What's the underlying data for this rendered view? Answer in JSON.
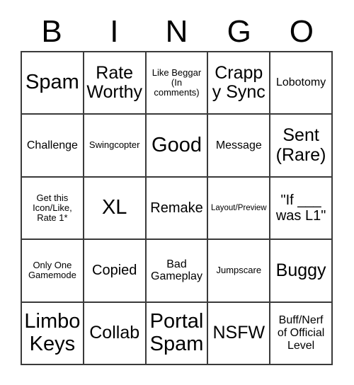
{
  "card": {
    "title": "BINGO",
    "header_letters": [
      "B",
      "I",
      "N",
      "G",
      "O"
    ],
    "grid_size": "5x5",
    "colors": {
      "background": "#ffffff",
      "text": "#000000",
      "grid_line": "#3a3a3a"
    },
    "rows": [
      [
        {
          "label": "Spam",
          "size": "fs-xl"
        },
        {
          "label": "Rate Worthy",
          "size": "fs-lg"
        },
        {
          "label": "Like Beggar (In comments)",
          "size": "fs-xs"
        },
        {
          "label": "Crappy Sync",
          "size": "fs-lg"
        },
        {
          "label": "Lobotomy",
          "size": "fs-sm"
        }
      ],
      [
        {
          "label": "Challenge",
          "size": "fs-sm"
        },
        {
          "label": "Swingcopter",
          "size": "fs-xs"
        },
        {
          "label": "Good",
          "size": "fs-xl"
        },
        {
          "label": "Message",
          "size": "fs-sm"
        },
        {
          "label": "Sent (Rare)",
          "size": "fs-lg"
        }
      ],
      [
        {
          "label": "Get this Icon/Like, Rate 1*",
          "size": "fs-xs"
        },
        {
          "label": "XL",
          "size": "fs-xl"
        },
        {
          "label": "Remake",
          "size": "fs-md"
        },
        {
          "label": "Layout/Preview",
          "size": "fs-xxs"
        },
        {
          "label": "\"If ___ was L1\"",
          "size": "fs-md"
        }
      ],
      [
        {
          "label": "Only One Gamemode",
          "size": "fs-xs"
        },
        {
          "label": "Copied",
          "size": "fs-md"
        },
        {
          "label": "Bad Gameplay",
          "size": "fs-sm"
        },
        {
          "label": "Jumpscare",
          "size": "fs-xs"
        },
        {
          "label": "Buggy",
          "size": "fs-lg"
        }
      ],
      [
        {
          "label": "Limbo Keys",
          "size": "fs-xl"
        },
        {
          "label": "Collab",
          "size": "fs-lg"
        },
        {
          "label": "Portal Spam",
          "size": "fs-xl"
        },
        {
          "label": "NSFW",
          "size": "fs-lg"
        },
        {
          "label": "Buff/Nerf of Official Level",
          "size": "fs-sm"
        }
      ]
    ]
  }
}
